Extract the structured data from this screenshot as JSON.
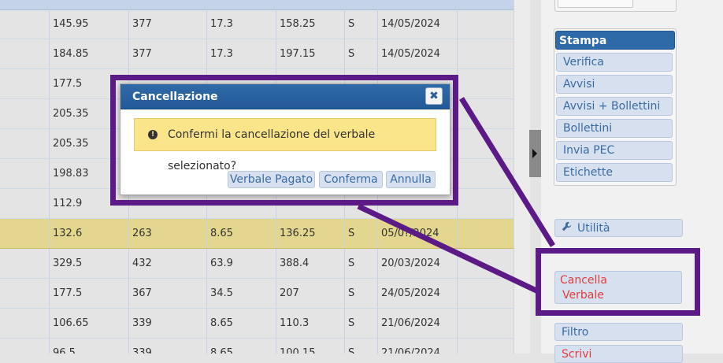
{
  "grid": {
    "rows": [
      [
        "145.95",
        "377",
        "17.3",
        "158.25",
        "S",
        "14/05/2024"
      ],
      [
        "184.85",
        "377",
        "17.3",
        "197.15",
        "S",
        "14/05/2024"
      ],
      [
        "177.5",
        "",
        "",
        "",
        "",
        ""
      ],
      [
        "205.35",
        "",
        "",
        "",
        "",
        ""
      ],
      [
        "205.35",
        "",
        "",
        "",
        "",
        ""
      ],
      [
        "198.83",
        "",
        "",
        "",
        "",
        ""
      ],
      [
        "112.9",
        "",
        "",
        "",
        "",
        ""
      ],
      [
        "132.6",
        "263",
        "8.65",
        "136.25",
        "S",
        "05/0?/2024"
      ],
      [
        "329.5",
        "432",
        "63.9",
        "388.4",
        "S",
        "20/03/2024"
      ],
      [
        "177.5",
        "367",
        "34.5",
        "207",
        "S",
        "24/05/2024"
      ],
      [
        "106.65",
        "339",
        "8.65",
        "110.3",
        "S",
        "21/06/2024"
      ],
      [
        "96.5",
        "339",
        "8.65",
        "100.15",
        "S",
        "21/06/2024"
      ]
    ],
    "selected_row": 7
  },
  "side": {
    "stampa_header": "Stampa",
    "stampa_items": [
      "Verifica",
      "Avvisi",
      "Avvisi + Bollettini",
      "Bollettini",
      "Invia PEC",
      "Etichette"
    ],
    "utilita_label": "Utilità",
    "cancella_line1": "Cancella",
    "cancella_line2": "Verbale",
    "filtro_label": "Filtro",
    "scrivi_label": "Scrivi"
  },
  "dialog": {
    "title": "Cancellazione",
    "close_glyph": "✖",
    "message": "Confermi la cancellazione del verbale selezionato?",
    "buttons": {
      "verbale_pagato": "Verbale Pagato",
      "conferma": "Conferma",
      "annulla": "Annulla"
    }
  },
  "colors": {
    "highlight": "#5b1a85",
    "title_bar": "#2f6aa8",
    "warning_bg": "#fbe58b",
    "danger_text": "#e03e3e"
  }
}
